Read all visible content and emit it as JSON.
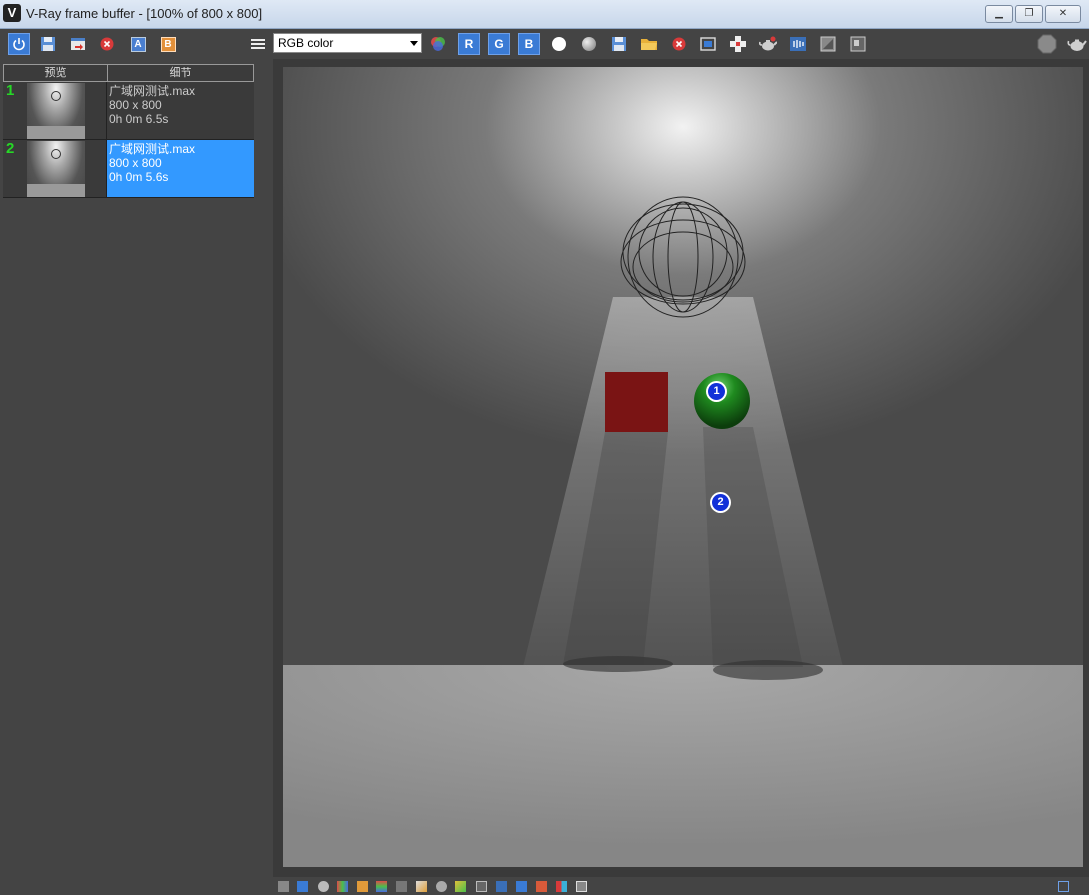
{
  "window": {
    "title": "V-Ray frame buffer - [100% of 800 x 800]",
    "app_icon": "vray-logo-icon",
    "buttons": [
      "minimize",
      "restore",
      "close"
    ]
  },
  "toolbar": {
    "left_icons": [
      "power-icon",
      "save-icon",
      "export-icon",
      "clear-icon",
      "compare-a-icon",
      "compare-b-icon",
      "menu-icon"
    ],
    "compare_a_label": "A",
    "compare_b_label": "B",
    "channel_select": {
      "value": "RGB color"
    },
    "r_label": "R",
    "g_label": "G",
    "b_label": "B",
    "right_icons": [
      "channel-color-icon",
      "white-circle-icon",
      "grey-circle-icon",
      "save-image-icon",
      "open-folder-icon",
      "close-image-icon",
      "region-icon",
      "follow-mouse-icon",
      "render-teapot-icon",
      "lens-effects-icon",
      "display-correction-icon",
      "stamp-icon",
      "stop-icon",
      "teapot-icon"
    ],
    "stop_label": "STOP",
    "colors": {
      "blue_button": "#3a7bd5",
      "red_icon": "#d83a3a",
      "orange_icon": "#e2903a"
    }
  },
  "history": {
    "col_preview": "预览",
    "col_details": "细节",
    "items": [
      {
        "num": "1",
        "name": "广域网测试.max",
        "size": "800 x 800",
        "time": "0h 0m 6.5s",
        "selected": false
      },
      {
        "num": "2",
        "name": "广域网测试.max",
        "size": "800 x 800",
        "time": "0h 0m 5.6s",
        "selected": true
      }
    ],
    "colors": {
      "selected": "#3399ff",
      "number": "#26d826"
    }
  },
  "render": {
    "markers": [
      {
        "label": "1"
      },
      {
        "label": "2"
      }
    ],
    "colors": {
      "sphere": "#1f8a1f",
      "cube": "#7a1414",
      "wall": "#4c4c4c",
      "floor": "#8a8a8a"
    }
  },
  "statusbar": {
    "icons": [
      "panel-icon",
      "history-icon",
      "info-icon",
      "color-icon",
      "hsl-icon",
      "curves-icon",
      "levels-icon",
      "exposure-icon",
      "white-balance-icon",
      "lut-icon",
      "graph-icon",
      "ocio-icon",
      "layers-icon",
      "fit-icon",
      "split-icon",
      "sharpen-icon",
      "maximize-icon"
    ]
  }
}
